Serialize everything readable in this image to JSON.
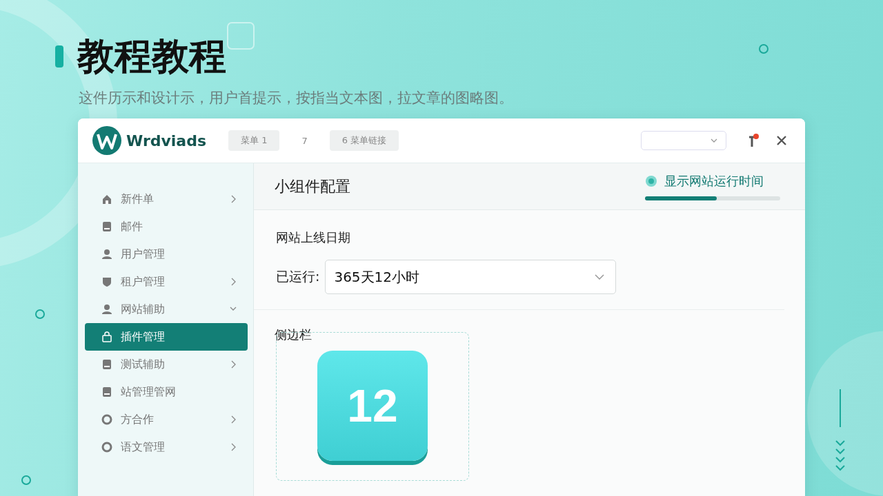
{
  "heading": {
    "title": "教程教程",
    "subtitle": "这件历示和设计示，用户首提示，按指当文本图，拉文章的图略图。"
  },
  "app": {
    "logo": "Wrdviads",
    "tabs": [
      {
        "label": "菜单 1",
        "selected": true
      },
      {
        "label": "7",
        "selected": false
      },
      {
        "label": "6 菜单链接",
        "selected": true
      }
    ],
    "notification": true
  },
  "sidebar": {
    "items": [
      {
        "label": "新件单",
        "kind": "home",
        "expandable": true,
        "expanded": false,
        "selected": false
      },
      {
        "label": "邮件",
        "kind": "doc",
        "expandable": false,
        "selected": false
      },
      {
        "label": "用户管理",
        "kind": "user",
        "expandable": false,
        "selected": false
      },
      {
        "label": "租户管理",
        "kind": "shield",
        "expandable": true,
        "expanded": false,
        "selected": false
      },
      {
        "label": "网站辅助",
        "kind": "user",
        "expandable": true,
        "expanded": true,
        "selected": false
      },
      {
        "label": "插件管理",
        "kind": "lock",
        "expandable": false,
        "selected": true
      },
      {
        "label": "测试辅助",
        "kind": "doc",
        "expandable": true,
        "expanded": false,
        "selected": false
      },
      {
        "label": "站管理管网",
        "kind": "doc",
        "expandable": false,
        "selected": false
      },
      {
        "label": "方合作",
        "kind": "circle",
        "expandable": true,
        "expanded": false,
        "selected": false
      },
      {
        "label": "语文管理",
        "kind": "circle",
        "expandable": true,
        "expanded": false,
        "selected": false
      }
    ]
  },
  "panel": {
    "title": "小组件配置",
    "toggle": {
      "label": "显示网站运行时间",
      "level": 0.53
    },
    "date_label": "网站上线日期",
    "runtime_label": "已运行:",
    "runtime_value": "365天12小时",
    "widget_label": "侧边栏",
    "widget_number": "12"
  }
}
